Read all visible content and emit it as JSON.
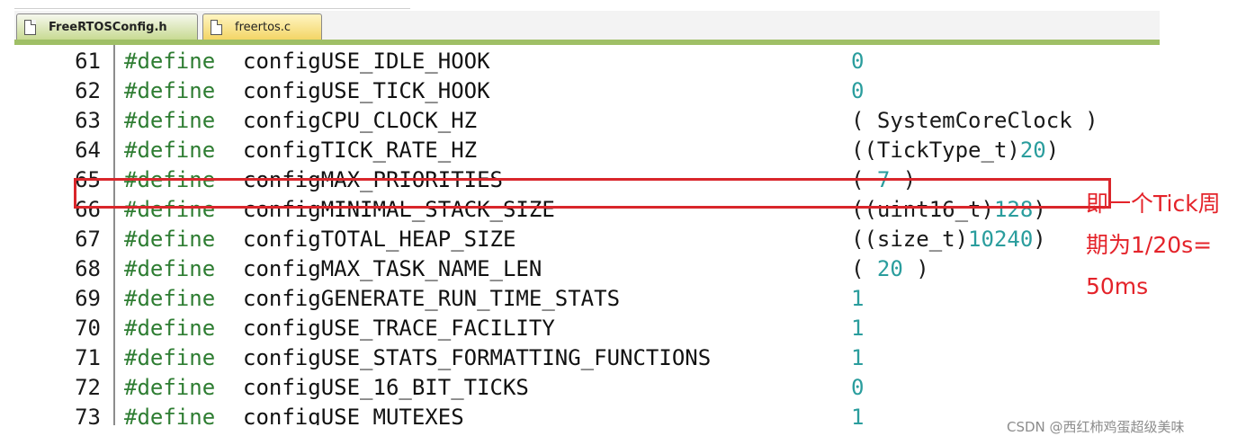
{
  "tabs": [
    {
      "label": "FreeRTOSConfig.h",
      "active": true
    },
    {
      "label": "freertos.c",
      "active": false
    }
  ],
  "lines": [
    {
      "num": "61",
      "kw": "#define",
      "name": "configUSE_IDLE_HOOK",
      "pre": "",
      "n": "0",
      "post": ""
    },
    {
      "num": "62",
      "kw": "#define",
      "name": "configUSE_TICK_HOOK",
      "pre": "",
      "n": "0",
      "post": ""
    },
    {
      "num": "63",
      "kw": "#define",
      "name": "configCPU_CLOCK_HZ",
      "pre": "( SystemCoreClock )",
      "n": "",
      "post": ""
    },
    {
      "num": "64",
      "kw": "#define",
      "name": "configTICK_RATE_HZ",
      "pre": "((TickType_t)",
      "n": "20",
      "post": ")"
    },
    {
      "num": "65",
      "kw": "#define",
      "name": "configMAX_PRIORITIES",
      "pre": "( ",
      "n": "7",
      "post": " )"
    },
    {
      "num": "66",
      "kw": "#define",
      "name": "configMINIMAL_STACK_SIZE",
      "pre": "((uint16_t)",
      "n": "128",
      "post": ")"
    },
    {
      "num": "67",
      "kw": "#define",
      "name": "configTOTAL_HEAP_SIZE",
      "pre": "((size_t)",
      "n": "10240",
      "post": ")"
    },
    {
      "num": "68",
      "kw": "#define",
      "name": "configMAX_TASK_NAME_LEN",
      "pre": "( ",
      "n": "20",
      "post": " )"
    },
    {
      "num": "69",
      "kw": "#define",
      "name": "configGENERATE_RUN_TIME_STATS",
      "pre": "",
      "n": "1",
      "post": ""
    },
    {
      "num": "70",
      "kw": "#define",
      "name": "configUSE_TRACE_FACILITY",
      "pre": "",
      "n": "1",
      "post": ""
    },
    {
      "num": "71",
      "kw": "#define",
      "name": "configUSE_STATS_FORMATTING_FUNCTIONS",
      "pre": "",
      "n": "1",
      "post": ""
    },
    {
      "num": "72",
      "kw": "#define",
      "name": "configUSE_16_BIT_TICKS",
      "pre": "",
      "n": "0",
      "post": ""
    },
    {
      "num": "73",
      "kw": "#define",
      "name": "configUSE_MUTEXES",
      "pre": "",
      "n": "1",
      "post": ""
    }
  ],
  "annotation": {
    "lines": [
      "即一个Tick周",
      "期为1/20s=",
      "50ms"
    ]
  },
  "watermark": "CSDN @西红柿鸡蛋超级美味",
  "colors": {
    "keyword": "#2e7d32",
    "number": "#2a9d9d",
    "highlight": "#d9262b",
    "annotation": "#e4232a"
  }
}
